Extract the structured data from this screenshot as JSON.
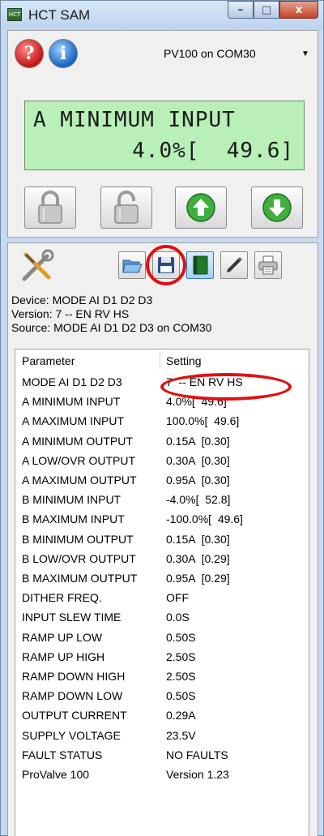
{
  "window": {
    "title": "HCT SAM",
    "app_icon_text": "HCT"
  },
  "caption": {
    "minimize": "–",
    "maximize": "□",
    "close": "x"
  },
  "toolbar_top": {
    "help_glyph": "?",
    "info_glyph": "i",
    "port_select": {
      "value": "PV100 on COM30"
    }
  },
  "display": {
    "line1": "A MINIMUM INPUT",
    "line2": "4.0%[  49.6]",
    "bg_color": "#b8f0b8"
  },
  "buttons": [
    {
      "icon": "lock-icon"
    },
    {
      "icon": "unlock-icon"
    },
    {
      "icon": "up-arrow-icon"
    },
    {
      "icon": "down-arrow-icon"
    }
  ],
  "tools": [
    {
      "icon": "tools-icon"
    },
    {
      "icon": "open-folder-icon"
    },
    {
      "icon": "save-icon"
    },
    {
      "icon": "book-icon"
    },
    {
      "icon": "pen-icon"
    },
    {
      "icon": "printer-icon"
    }
  ],
  "info": {
    "device": "Device: MODE AI D1 D2 D3",
    "version": "Version:  7  -- EN RV HS",
    "source": "Source: MODE AI D1 D2 D3 on COM30"
  },
  "table": {
    "headers": {
      "parameter": "Parameter",
      "setting": "Setting"
    },
    "rows": [
      {
        "parameter": "MODE AI D1 D2 D3",
        "setting": "7  -- EN RV HS"
      },
      {
        "parameter": "A MINIMUM INPUT",
        "setting": "4.0%[  49.6]"
      },
      {
        "parameter": "A MAXIMUM INPUT",
        "setting": "100.0%[  49.6]"
      },
      {
        "parameter": "A MINIMUM OUTPUT",
        "setting": "0.15A  [0.30]"
      },
      {
        "parameter": "A LOW/OVR OUTPUT",
        "setting": "0.30A  [0.30]"
      },
      {
        "parameter": "A MAXIMUM OUTPUT",
        "setting": "0.95A  [0.30]"
      },
      {
        "parameter": "B MINIMUM INPUT",
        "setting": "-4.0%[  52.8]"
      },
      {
        "parameter": "B MAXIMUM INPUT",
        "setting": "-100.0%[  49.6]"
      },
      {
        "parameter": "B MINIMUM OUTPUT",
        "setting": "0.15A  [0.30]"
      },
      {
        "parameter": "B LOW/OVR OUTPUT",
        "setting": "0.30A  [0.29]"
      },
      {
        "parameter": "B MAXIMUM OUTPUT",
        "setting": "0.95A  [0.29]"
      },
      {
        "parameter": "DITHER FREQ.",
        "setting": "OFF"
      },
      {
        "parameter": "INPUT SLEW TIME",
        "setting": "0.0S"
      },
      {
        "parameter": "RAMP UP LOW",
        "setting": "0.50S"
      },
      {
        "parameter": "RAMP UP HIGH",
        "setting": "2.50S"
      },
      {
        "parameter": "RAMP DOWN HIGH",
        "setting": "2.50S"
      },
      {
        "parameter": "RAMP DOWN LOW",
        "setting": "0.50S"
      },
      {
        "parameter": "OUTPUT CURRENT",
        "setting": "0.29A"
      },
      {
        "parameter": "SUPPLY VOLTAGE",
        "setting": "23.5V"
      },
      {
        "parameter": "FAULT STATUS",
        "setting": "NO FAULTS"
      },
      {
        "parameter": "ProValve 100",
        "setting": "Version 1.23"
      }
    ]
  },
  "colors": {
    "highlight_circle": "#e01010",
    "accent": "#1464c4"
  }
}
